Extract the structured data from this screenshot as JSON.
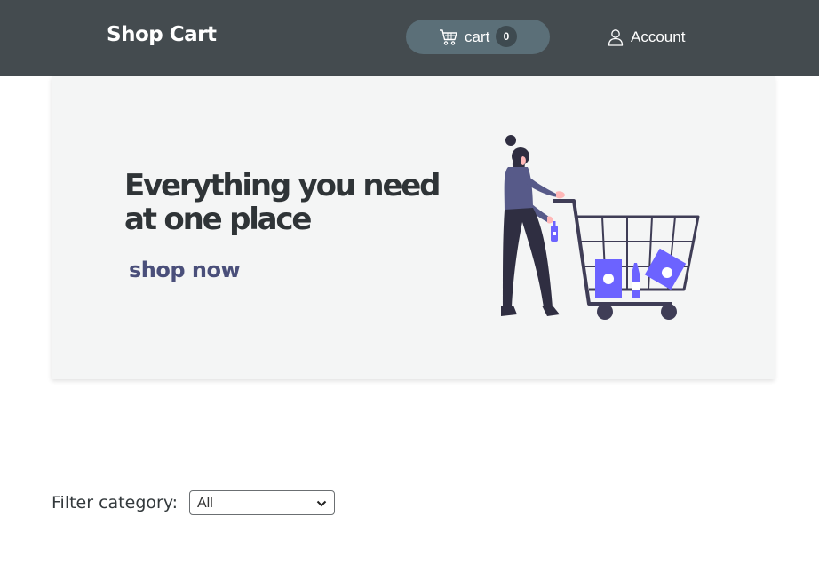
{
  "header": {
    "brand": "Shop Cart",
    "cart": {
      "label": "cart",
      "count": "0",
      "icon": "shopping-cart-icon"
    },
    "account": {
      "label": "Account",
      "icon": "user-icon"
    }
  },
  "hero": {
    "title": "Everything you need at one place",
    "cta_label": "shop now",
    "illustration": "woman-pushing-shopping-cart-illustration"
  },
  "filter": {
    "label": "Filter category:",
    "selected": "All"
  },
  "colors": {
    "navbar": "#444b4f",
    "cart_pill": "#5b6f78",
    "accent_purple": "#6c63ff",
    "cta": "#4a4f7a"
  }
}
